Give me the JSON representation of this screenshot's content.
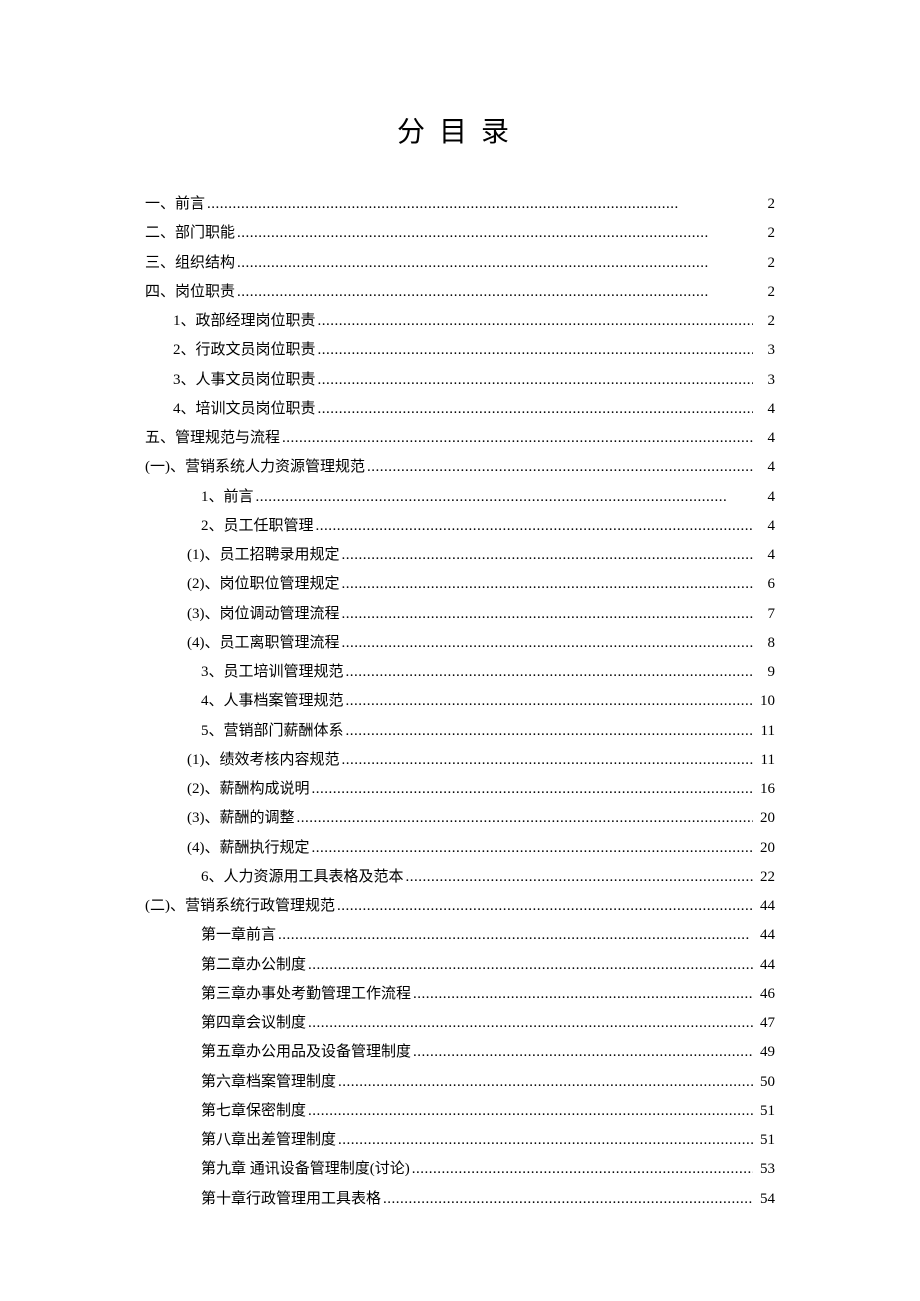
{
  "title": "分目录",
  "toc": [
    {
      "label": "一、前言",
      "page": "2",
      "indent": 0
    },
    {
      "label": "二、部门职能",
      "page": "2",
      "indent": 0
    },
    {
      "label": "三、组织结构",
      "page": "2",
      "indent": 0
    },
    {
      "label": "四、岗位职责",
      "page": "2",
      "indent": 0
    },
    {
      "label": "1、政部经理岗位职责",
      "page": "2",
      "indent": 1
    },
    {
      "label": "2、行政文员岗位职责",
      "page": "3",
      "indent": 1
    },
    {
      "label": "3、人事文员岗位职责",
      "page": "3",
      "indent": 1
    },
    {
      "label": "4、培训文员岗位职责",
      "page": "4",
      "indent": 1
    },
    {
      "label": "五、管理规范与流程",
      "page": "4",
      "indent": 0
    },
    {
      "label": "(一)、营销系统人力资源管理规范",
      "page": "4",
      "indent": 0
    },
    {
      "label": "1、前言",
      "page": "4",
      "indent": 3
    },
    {
      "label": "2、员工任职管理",
      "page": "4",
      "indent": 3
    },
    {
      "label": "(1)、员工招聘录用规定",
      "page": "4",
      "indent": 2
    },
    {
      "label": "(2)、岗位职位管理规定",
      "page": "6",
      "indent": 2
    },
    {
      "label": "(3)、岗位调动管理流程",
      "page": "7",
      "indent": 2
    },
    {
      "label": "(4)、员工离职管理流程",
      "page": "8",
      "indent": 2
    },
    {
      "label": "3、员工培训管理规范",
      "page": "9",
      "indent": 3
    },
    {
      "label": "4、人事档案管理规范",
      "page": "10",
      "indent": 3
    },
    {
      "label": "5、营销部门薪酬体系",
      "page": "11",
      "indent": 3
    },
    {
      "label": "(1)、绩效考核内容规范",
      "page": "11",
      "indent": 2
    },
    {
      "label": "(2)、薪酬构成说明",
      "page": "16",
      "indent": 2
    },
    {
      "label": "(3)、薪酬的调整",
      "page": "20",
      "indent": 2
    },
    {
      "label": "(4)、薪酬执行规定",
      "page": "20",
      "indent": 2
    },
    {
      "label": "6、人力资源用工具表格及范本",
      "page": "22",
      "indent": 3
    },
    {
      "label": "(二)、营销系统行政管理规范",
      "page": "44",
      "indent": 0
    },
    {
      "label": "第一章前言",
      "page": "44",
      "indent": 3
    },
    {
      "label": "第二章办公制度",
      "page": "44",
      "indent": 3
    },
    {
      "label": "第三章办事处考勤管理工作流程",
      "page": "46",
      "indent": 3
    },
    {
      "label": "第四章会议制度",
      "page": "47",
      "indent": 3
    },
    {
      "label": "第五章办公用品及设备管理制度",
      "page": "49",
      "indent": 3
    },
    {
      "label": "第六章档案管理制度",
      "page": "50",
      "indent": 3
    },
    {
      "label": "第七章保密制度",
      "page": "51",
      "indent": 3
    },
    {
      "label": "第八章出差管理制度",
      "page": "51",
      "indent": 3
    },
    {
      "label": "第九章  通讯设备管理制度(讨论)",
      "page": "53",
      "indent": 3
    },
    {
      "label": "第十章行政管理用工具表格",
      "page": "54",
      "indent": 3
    }
  ]
}
